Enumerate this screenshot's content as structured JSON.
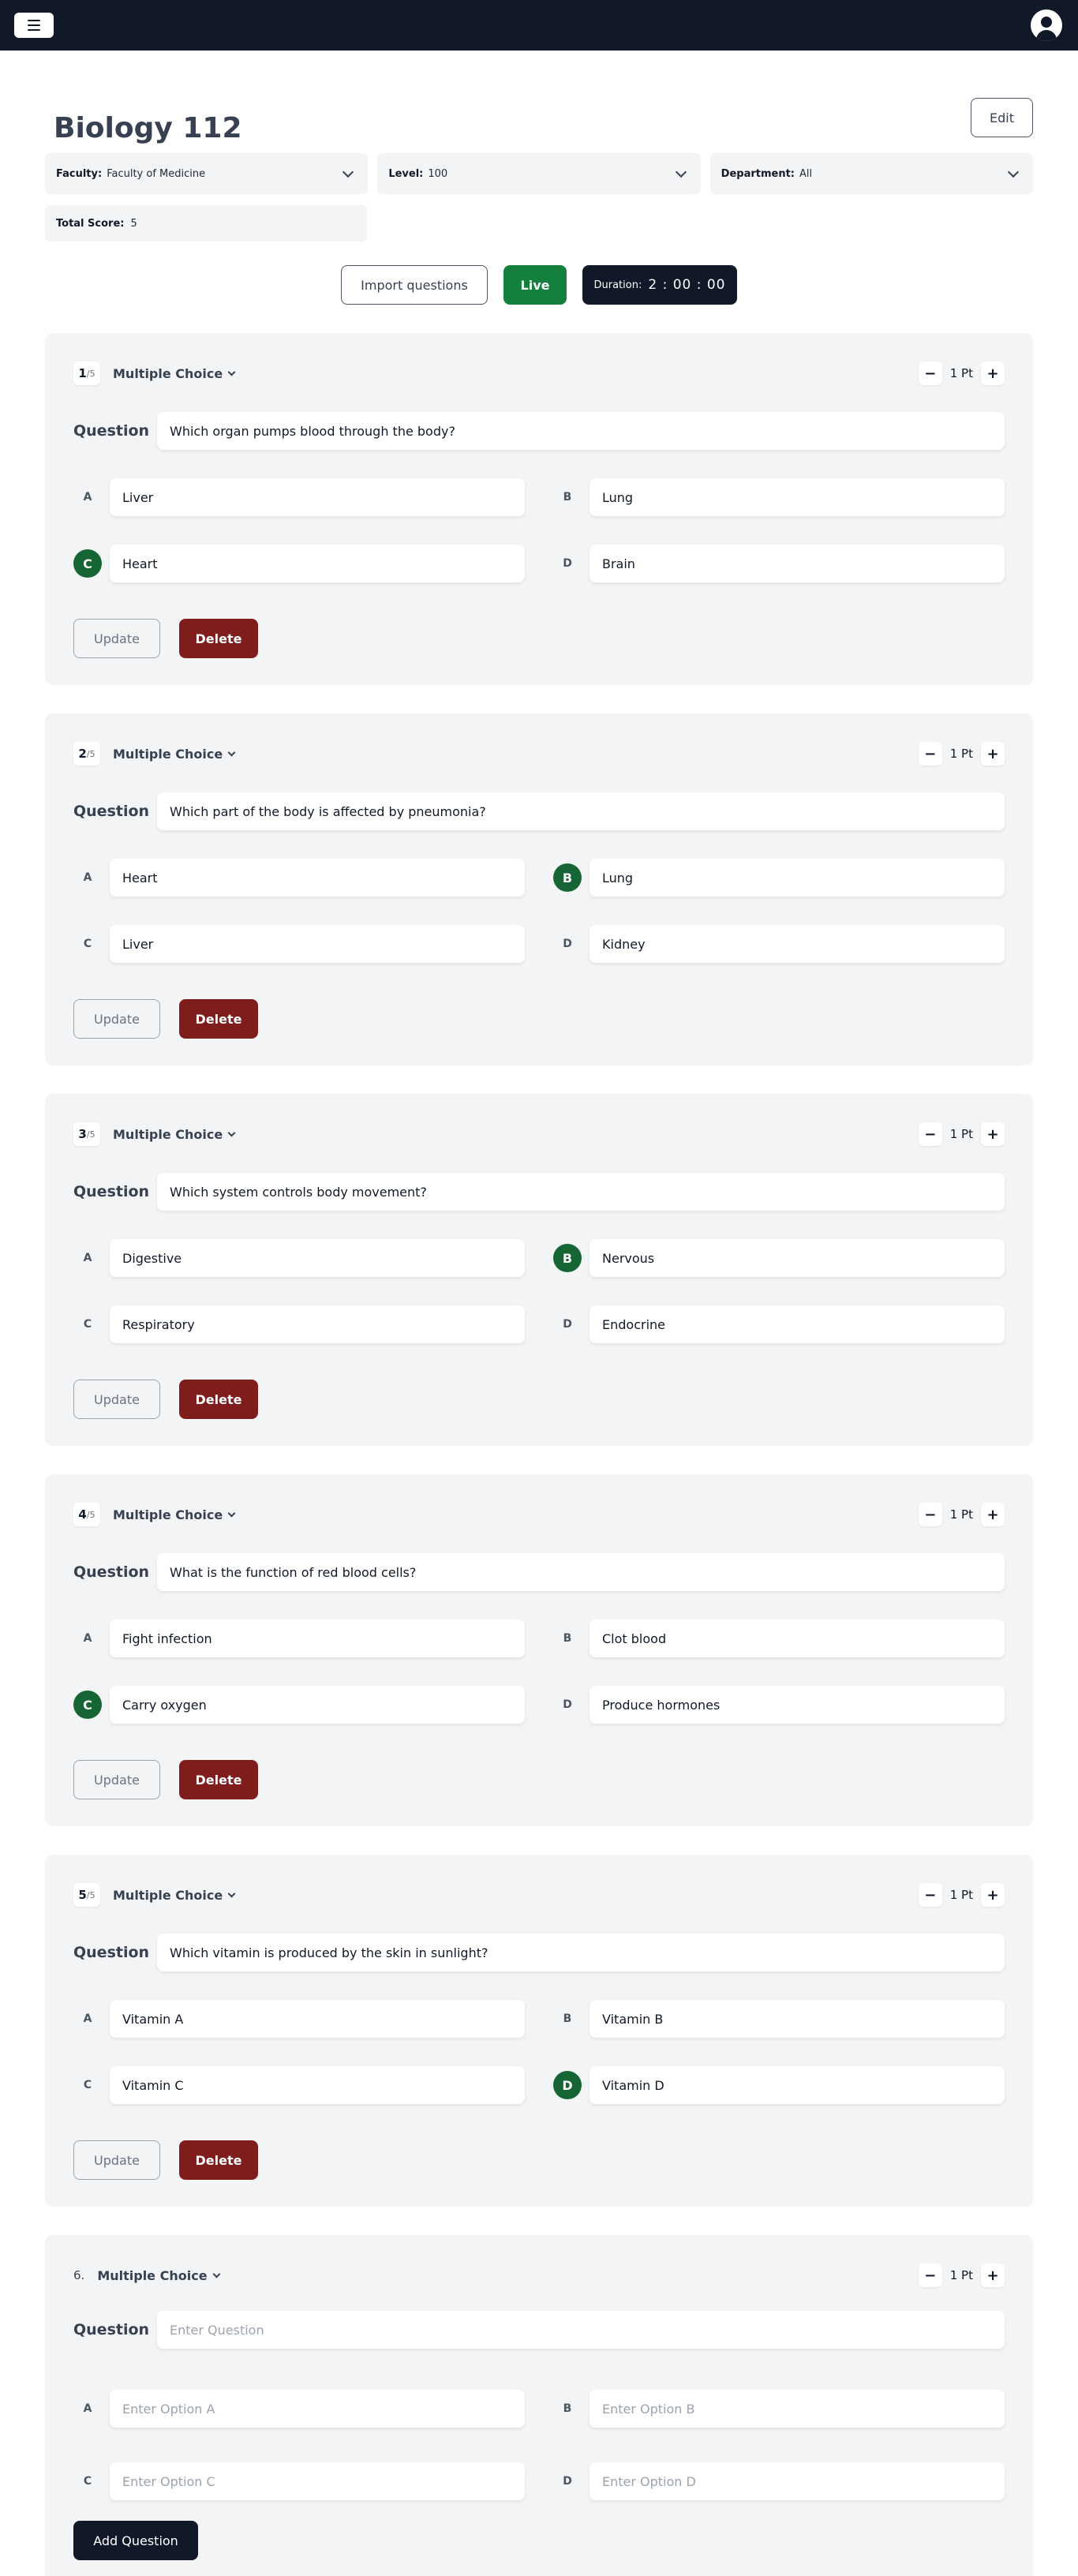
{
  "topbar": {
    "menu_icon": "hamburger-icon",
    "avatar_icon": "user-avatar-icon"
  },
  "page": {
    "title": "Biology 112",
    "edit_label": "Edit"
  },
  "filters": [
    {
      "label": "Faculty:",
      "value": "Faculty of Medicine"
    },
    {
      "label": "Level:",
      "value": "100"
    },
    {
      "label": "Department:",
      "value": "All"
    }
  ],
  "total": {
    "label": "Total Score:",
    "value": "5"
  },
  "actions": {
    "import_label": "Import questions",
    "live_label": "Live",
    "duration_label": "Duration:",
    "duration_value": "2 : 00 : 00"
  },
  "colors": {
    "topbar": "#111827",
    "live": "#15803d",
    "delete": "#7f1d1d",
    "correct": "#166534",
    "card": "#f3f4f6"
  },
  "questions": [
    {
      "num": "1",
      "of": "/5",
      "type": "Multiple Choice",
      "points": "1 Pt",
      "question_label": "Question",
      "question": "Which organ pumps blood through the body?",
      "options": [
        {
          "letter": "A",
          "text": "Liver"
        },
        {
          "letter": "B",
          "text": "Lung"
        },
        {
          "letter": "C",
          "text": "Heart"
        },
        {
          "letter": "D",
          "text": "Brain"
        }
      ],
      "correct": "C",
      "update_label": "Update",
      "delete_label": "Delete"
    },
    {
      "num": "2",
      "of": "/5",
      "type": "Multiple Choice",
      "points": "1 Pt",
      "question_label": "Question",
      "question": "Which part of the body is affected by pneumonia?",
      "options": [
        {
          "letter": "A",
          "text": "Heart"
        },
        {
          "letter": "B",
          "text": "Lung"
        },
        {
          "letter": "C",
          "text": "Liver"
        },
        {
          "letter": "D",
          "text": "Kidney"
        }
      ],
      "correct": "B",
      "update_label": "Update",
      "delete_label": "Delete"
    },
    {
      "num": "3",
      "of": "/5",
      "type": "Multiple Choice",
      "points": "1 Pt",
      "question_label": "Question",
      "question": "Which system controls body movement?",
      "options": [
        {
          "letter": "A",
          "text": "Digestive"
        },
        {
          "letter": "B",
          "text": "Nervous"
        },
        {
          "letter": "C",
          "text": "Respiratory"
        },
        {
          "letter": "D",
          "text": "Endocrine"
        }
      ],
      "correct": "B",
      "update_label": "Update",
      "delete_label": "Delete"
    },
    {
      "num": "4",
      "of": "/5",
      "type": "Multiple Choice",
      "points": "1 Pt",
      "question_label": "Question",
      "question": "What is the function of red blood cells?",
      "options": [
        {
          "letter": "A",
          "text": "Fight infection"
        },
        {
          "letter": "B",
          "text": "Clot blood"
        },
        {
          "letter": "C",
          "text": "Carry oxygen"
        },
        {
          "letter": "D",
          "text": "Produce hormones"
        }
      ],
      "correct": "C",
      "update_label": "Update",
      "delete_label": "Delete"
    },
    {
      "num": "5",
      "of": "/5",
      "type": "Multiple Choice",
      "points": "1 Pt",
      "question_label": "Question",
      "question": "Which vitamin is produced by the skin in sunlight?",
      "options": [
        {
          "letter": "A",
          "text": "Vitamin A"
        },
        {
          "letter": "B",
          "text": "Vitamin B"
        },
        {
          "letter": "C",
          "text": "Vitamin C"
        },
        {
          "letter": "D",
          "text": "Vitamin D"
        }
      ],
      "correct": "D",
      "update_label": "Update",
      "delete_label": "Delete"
    }
  ],
  "new_question": {
    "num": "6.",
    "type": "Multiple Choice",
    "points": "1 Pt",
    "question_label": "Question",
    "question_placeholder": "Enter Question",
    "options": [
      {
        "letter": "A",
        "placeholder": "Enter Option A"
      },
      {
        "letter": "B",
        "placeholder": "Enter Option B"
      },
      {
        "letter": "C",
        "placeholder": "Enter Option C"
      },
      {
        "letter": "D",
        "placeholder": "Enter Option D"
      }
    ],
    "add_label": "Add Question"
  },
  "ui": {
    "minus": "−",
    "plus": "+"
  }
}
